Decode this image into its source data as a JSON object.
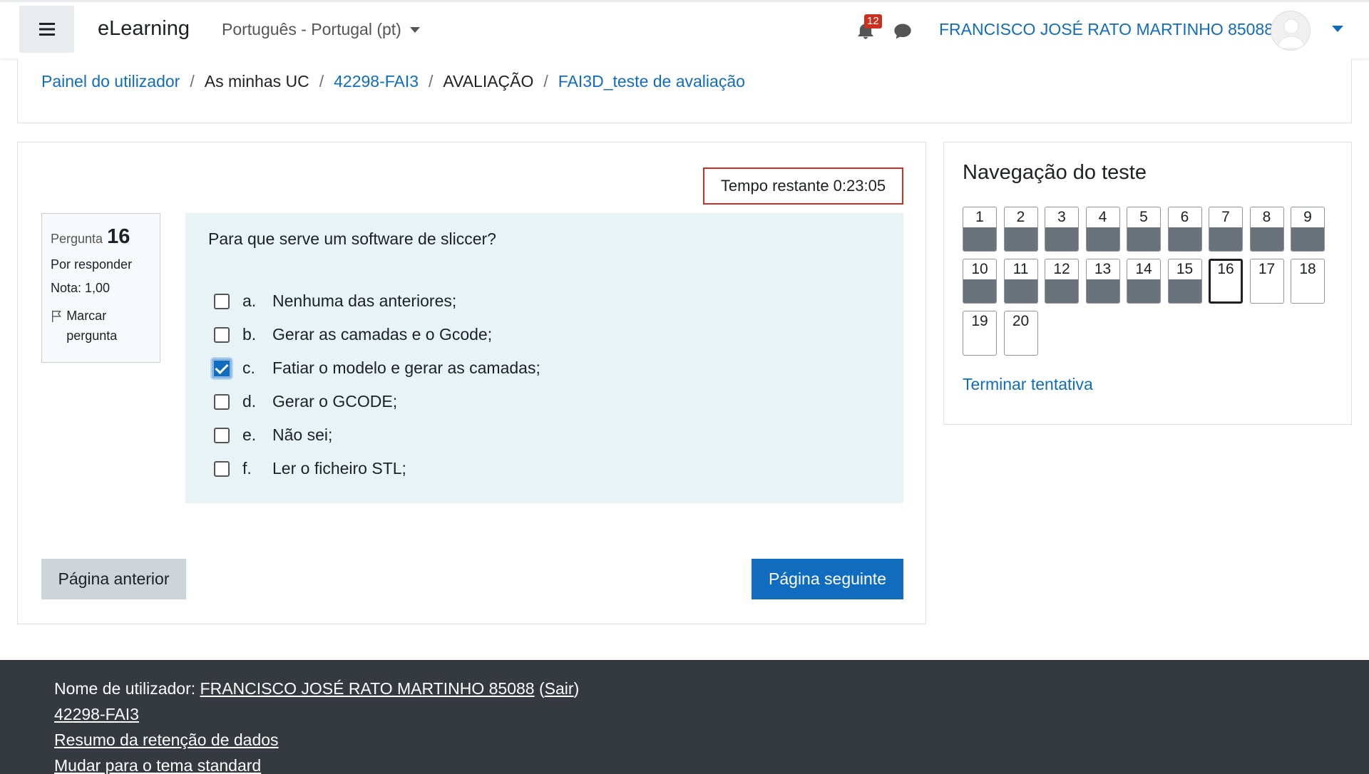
{
  "header": {
    "brand": "eLearning",
    "language": "Português - Portugal (pt)",
    "notification_count": "12",
    "user_name": "FRANCISCO JOSÉ RATO MARTINHO 85088"
  },
  "breadcrumb": {
    "items": [
      "Painel do utilizador",
      "As minhas UC",
      "42298-FAI3",
      "AVALIAÇÃO",
      "FAI3D_teste de avaliação"
    ],
    "separator": "/"
  },
  "quiz": {
    "timer": "Tempo restante 0:23:05",
    "info": {
      "question_label": "Pergunta",
      "question_number": "16",
      "status": "Por responder",
      "grade": "Nota: 1,00",
      "flag_label": "Marcar pergunta"
    },
    "question_text": "Para que serve um software de sliccer?",
    "answers": [
      {
        "letter": "a.",
        "text": "Nenhuma das anteriores;",
        "checked": false
      },
      {
        "letter": "b.",
        "text": "Gerar as camadas e o Gcode;",
        "checked": false
      },
      {
        "letter": "c.",
        "text": "Fatiar o modelo e gerar as camadas;",
        "checked": true
      },
      {
        "letter": "d.",
        "text": "Gerar o GCODE;",
        "checked": false
      },
      {
        "letter": "e.",
        "text": "Não sei;",
        "checked": false
      },
      {
        "letter": "f.",
        "text": "Ler o ficheiro STL;",
        "checked": false
      }
    ],
    "prev_button": "Página anterior",
    "next_button": "Página seguinte"
  },
  "navigation": {
    "title": "Navegação do teste",
    "questions": [
      {
        "n": "1",
        "state": "answered"
      },
      {
        "n": "2",
        "state": "answered"
      },
      {
        "n": "3",
        "state": "answered"
      },
      {
        "n": "4",
        "state": "answered"
      },
      {
        "n": "5",
        "state": "answered"
      },
      {
        "n": "6",
        "state": "answered"
      },
      {
        "n": "7",
        "state": "answered"
      },
      {
        "n": "8",
        "state": "answered"
      },
      {
        "n": "9",
        "state": "answered"
      },
      {
        "n": "10",
        "state": "answered"
      },
      {
        "n": "11",
        "state": "answered"
      },
      {
        "n": "12",
        "state": "answered"
      },
      {
        "n": "13",
        "state": "answered"
      },
      {
        "n": "14",
        "state": "answered"
      },
      {
        "n": "15",
        "state": "answered"
      },
      {
        "n": "16",
        "state": "current"
      },
      {
        "n": "17",
        "state": "unanswered"
      },
      {
        "n": "18",
        "state": "unanswered"
      },
      {
        "n": "19",
        "state": "unanswered"
      },
      {
        "n": "20",
        "state": "unanswered"
      }
    ],
    "finish_link": "Terminar tentativa"
  },
  "footer": {
    "user_prefix": "Nome de utilizador:",
    "user_name": "FRANCISCO JOSÉ RATO MARTINHO 85088",
    "logout": "Sair",
    "course": "42298-FAI3",
    "data_retention": "Resumo da retenção de dados",
    "theme_switch": "Mudar para o tema standard"
  },
  "colors": {
    "primary": "#0f6cbf",
    "timer_border": "#ca3120",
    "question_bg": "#e7f3f5",
    "footer_bg": "#343a40",
    "answered_fill": "#6a737b"
  }
}
